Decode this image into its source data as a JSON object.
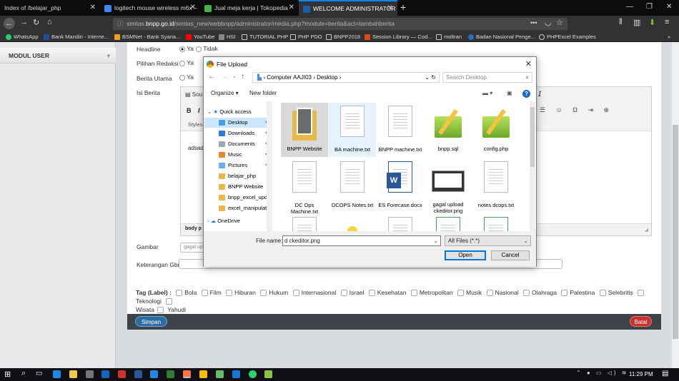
{
  "browser": {
    "tabs": [
      {
        "title": "Index of /belajar_php",
        "active": false
      },
      {
        "title": "logitech mouse wireless m6x –",
        "active": false
      },
      {
        "title": "Jual meja kerja | Tokopedia",
        "active": false
      },
      {
        "title": "WELCOME ADMINISTRATOR",
        "active": true
      }
    ],
    "url_prefix": "simtas.",
    "url_domain": "bnpp.go.id",
    "url_rest": "/simtas_new/webbnpp/administrator/media.php?module=berita&act=tambahberita",
    "bookmarks": [
      "WhatsApp",
      "Bank Mandiri - Interne...",
      "BSMNet - Bank Syaria...",
      "YouTube",
      "HSI",
      "TUTORIAL PHP",
      "PHP PDO",
      "BNPP2018",
      "Session Library — Cod...",
      "moltran",
      "Badan Nasional Penge...",
      "PHPExcel Examples"
    ]
  },
  "sidebar": {
    "modul_label": "MODUL USER"
  },
  "form": {
    "headline_label": "Headline",
    "pilihan_label": "Pilihan Redaksi",
    "utama_label": "Berita Utama",
    "isi_label": "Isi Berita",
    "ya": "Ya",
    "tidak": "Tidak",
    "editor_source": "Sou",
    "editor_styles": "Styles",
    "editor_body": "adsad",
    "editor_path": "body  p",
    "gambar_label": "Gambar",
    "gambar_value": "gagal up",
    "keterangan_label": "Keterangan Gbr",
    "tag_label": "Tag (Label) :",
    "tags": [
      "Bola",
      "Film",
      "Hiburan",
      "Hukum",
      "Internasional",
      "Israel",
      "Kesehatan",
      "Metropolitan",
      "Musik",
      "Nasional",
      "Olahraga",
      "Palestina",
      "Selebritis",
      "Teknologi",
      "Wisata",
      "Yahudi"
    ],
    "simpan": "Simpan",
    "batal": "Batal"
  },
  "dialog": {
    "title": "File Upload",
    "path": [
      "Computer AAJI03",
      "Desktop"
    ],
    "search_placeholder": "Search Desktop",
    "organize": "Organize ▾",
    "new_folder": "New folder",
    "nav": [
      {
        "label": "Quick access",
        "pinned": false
      },
      {
        "label": "Desktop",
        "pinned": true,
        "selected": true
      },
      {
        "label": "Downloads",
        "pinned": true
      },
      {
        "label": "Documents",
        "pinned": true
      },
      {
        "label": "Music",
        "pinned": true
      },
      {
        "label": "Pictures",
        "pinned": true
      },
      {
        "label": "belajar_php",
        "pinned": false
      },
      {
        "label": "BNPP Website",
        "pinned": false
      },
      {
        "label": "bnpp_excel_upda",
        "pinned": false
      },
      {
        "label": "excel_manipulati",
        "pinned": false
      },
      {
        "label": "OneDrive",
        "pinned": false
      }
    ],
    "files": [
      {
        "name": "BNPP Website",
        "kind": "folder"
      },
      {
        "name": "BA machine.txt",
        "kind": "txt"
      },
      {
        "name": "BNPP machine.txt",
        "kind": "txt"
      },
      {
        "name": "bnpp.sql",
        "kind": "notepad"
      },
      {
        "name": "config.php",
        "kind": "notepad"
      },
      {
        "name": "DC Ops Machine.txt",
        "kind": "txt"
      },
      {
        "name": "DCOPS Notes.txt",
        "kind": "txt"
      },
      {
        "name": "ES Forecase.docx",
        "kind": "word"
      },
      {
        "name": "gagal upload ckeditor.png",
        "kind": "image"
      },
      {
        "name": "notes dcops.txt",
        "kind": "txt"
      }
    ],
    "filename_label": "File name:",
    "filename_value": "d ckeditor.png",
    "filetype": "All Files (*.*)",
    "open": "Open",
    "cancel": "Cancel"
  },
  "taskbar": {
    "time": "11:29 PM"
  },
  "colors": {
    "accent": "#0a84ff",
    "simpan": "#2e6da4",
    "batal": "#c9302c"
  }
}
